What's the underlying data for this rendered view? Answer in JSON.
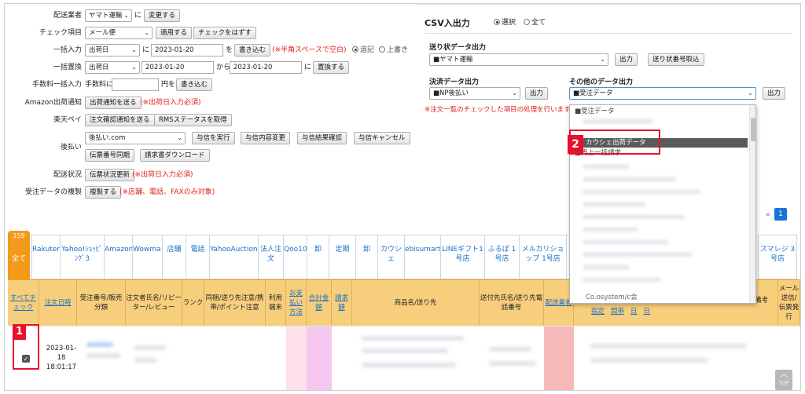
{
  "left_form": {
    "carrier": {
      "label": "配送業者",
      "value": "ヤマト運輸",
      "suffix": "に",
      "button": "変更する"
    },
    "check_item": {
      "label": "チェック項目",
      "value": "メール便",
      "apply": "適用する",
      "uncheck": "チェックをはずす"
    },
    "bulk_input": {
      "label": "一括入力",
      "field": "出荷日",
      "to": "に",
      "date": "2023-01-20",
      "wo": "を",
      "write": "書き込む",
      "note": "(※半角スペースで空白)",
      "opt_add": "追記",
      "opt_overwrite": "上書き"
    },
    "bulk_replace": {
      "label": "一括置換",
      "field": "出荷日",
      "date_from": "2023-01-20",
      "kara": "から",
      "date_to": "2023-01-20",
      "ni": "に",
      "button": "置換する"
    },
    "fee_bulk": {
      "label": "手数料一括入力",
      "prefix": "手数料に",
      "suffix": "円を",
      "button": "書き込む"
    },
    "amazon": {
      "label": "Amazon出荷通知",
      "button": "出荷通知を送る",
      "note": "(※出荷日入力必須)"
    },
    "rakuten": {
      "label": "楽天ペイ",
      "button1": "注文確認通知を送る",
      "button2": "RMSステータスを取得"
    },
    "atobarai": {
      "label": "後払い",
      "service": "後払い.com",
      "b1": "与信を実行",
      "b2": "与信内容変更",
      "b3": "与信結果確認",
      "b4": "与信キャンセル",
      "b5": "伝票番号同期",
      "b6": "請求書ダウンロード"
    },
    "delivery_status": {
      "label": "配送状況",
      "button": "伝票状況更新",
      "note": "(※出荷日入力必須)"
    },
    "copy": {
      "label": "受注データの複製",
      "button": "複製する",
      "note": "(※店舗、電話、FAXのみ対象)"
    }
  },
  "csv": {
    "title": "CSV入出力",
    "opt_selected": "選択",
    "opt_all": "全て",
    "slip": {
      "title": "送り状データ出力",
      "value": "■ヤマト運輸",
      "output": "出力",
      "import": "送り状番号取込"
    },
    "payment": {
      "title": "決済データ出力",
      "value": "■NP後払い",
      "output": "出力"
    },
    "other": {
      "title": "その他のデータ出力",
      "value": "■受注データ",
      "output": "出力"
    },
    "warning": "※注文一覧のチェックした項目の処理を行います。"
  },
  "dropdown": {
    "items": [
      "■受注データ",
      "カウシェ出荷データ",
      "■売上一括請求"
    ],
    "footer_text": "Co.osystem/c会"
  },
  "callouts": {
    "one": "1",
    "two": "2"
  },
  "pagination": {
    "prev": "«",
    "page": "1"
  },
  "tabs": [
    {
      "label": "全て",
      "count": "159"
    },
    {
      "label": "Rakuten2"
    },
    {
      "label": "Yahoo!ｼｮｯﾋﾟﾝｸﾞ3"
    },
    {
      "label": "Amazon4"
    },
    {
      "label": "Wowma!"
    },
    {
      "label": "店舗"
    },
    {
      "label": "電話"
    },
    {
      "label": "YahooAuction7"
    },
    {
      "label": "法人注文"
    },
    {
      "label": "Qoo10"
    },
    {
      "label": "卸"
    },
    {
      "label": "定期"
    },
    {
      "label": "卸"
    },
    {
      "label": "カウシェ"
    },
    {
      "label": "ebisumart"
    },
    {
      "label": "LINEギフト1号店"
    },
    {
      "label": "ふるぽ 1号店"
    },
    {
      "label": "メルカリショップ 1号店"
    },
    {
      "label": "スマレジ 3号店"
    }
  ],
  "table": {
    "headers": {
      "check_all": "すべてチェック",
      "order_date": "注文日時",
      "order_no": "受注番号/販売分類",
      "customer": "注文者氏名/リピーター/レビュー",
      "rank": "ランク",
      "bundle": "同梱/送り先注意/携帯/ポイント注意",
      "terminal": "利用端末",
      "pay_method": "お支払い方法",
      "total": "合計金額",
      "invoice": "請求額",
      "product": "商品名/送り先",
      "ship_to": "送付先氏名/送り先電話番号",
      "carrier": "配送業者",
      "sub1": "指定",
      "sub2": "間帯",
      "sub3": "日",
      "sub4": "日",
      "note": "備考",
      "mail": "メール送信/伝票発行"
    },
    "row": {
      "date": "2023-01-18 18:01:17"
    }
  },
  "top_button": "TOP"
}
